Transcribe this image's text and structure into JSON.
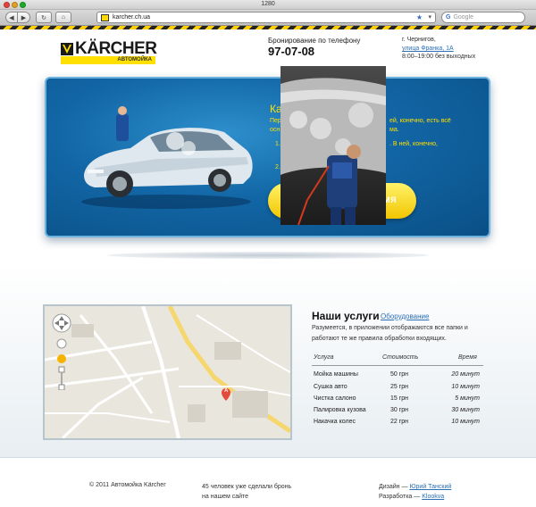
{
  "browser": {
    "window_title": "1280",
    "url": "karcher.ch.ua",
    "search_placeholder": "Google"
  },
  "header": {
    "logo_text": "KÄRCHER",
    "logo_subtitle": "АВТОМОЙКА",
    "phone_label": "Бронирование по телефону",
    "phone_number": "97-07-08",
    "address_city": "г. Чернигов,",
    "address_street": "улица Франка, 1А",
    "hours": "8:00–19:00 без выходных"
  },
  "banner": {
    "title": "Ка",
    "line1_left": "Пер",
    "line1_right": "ей, конечно, есть всё",
    "line2_left": "осн",
    "line2_right": "ма.",
    "item1_left": "1.",
    "item1_right": ". В ней, конечно,",
    "item2_left": "2.",
    "button_label": "МЯ"
  },
  "services": {
    "title": "Наши услуги",
    "link": "Оборудование",
    "description": "Разумеется, в приложении отображаются все папки и работают те же правила обработки входящих.",
    "columns": [
      "Услуга",
      "Стоимость",
      "Время"
    ],
    "rows": [
      {
        "name": "Мойка машины",
        "price": "50 грн",
        "time": "20 минут"
      },
      {
        "name": "Сушка авто",
        "price": "25 грн",
        "time": "10 минут"
      },
      {
        "name": "Чистка салоно",
        "price": "15 грн",
        "time": "5 минут"
      },
      {
        "name": "Палировка кузова",
        "price": "30 грн",
        "time": "30 минут"
      },
      {
        "name": "Накачка колес",
        "price": "22 грн",
        "time": "10 минут"
      }
    ]
  },
  "map": {
    "marker_label": "A"
  },
  "footer": {
    "copyright": "© 2011 Автомойка Kärcher",
    "count_line1": "45 человек уже сделали бронь",
    "count_line2": "на нашем сайте",
    "design_label": "Дизайн —",
    "design_name": "Юрий Танский",
    "dev_label": "Разработка —",
    "dev_name": "Klookva"
  },
  "colors": {
    "brand_yellow": "#ffe000",
    "banner_blue": "#1266a5",
    "link_blue": "#2b6fb7"
  }
}
